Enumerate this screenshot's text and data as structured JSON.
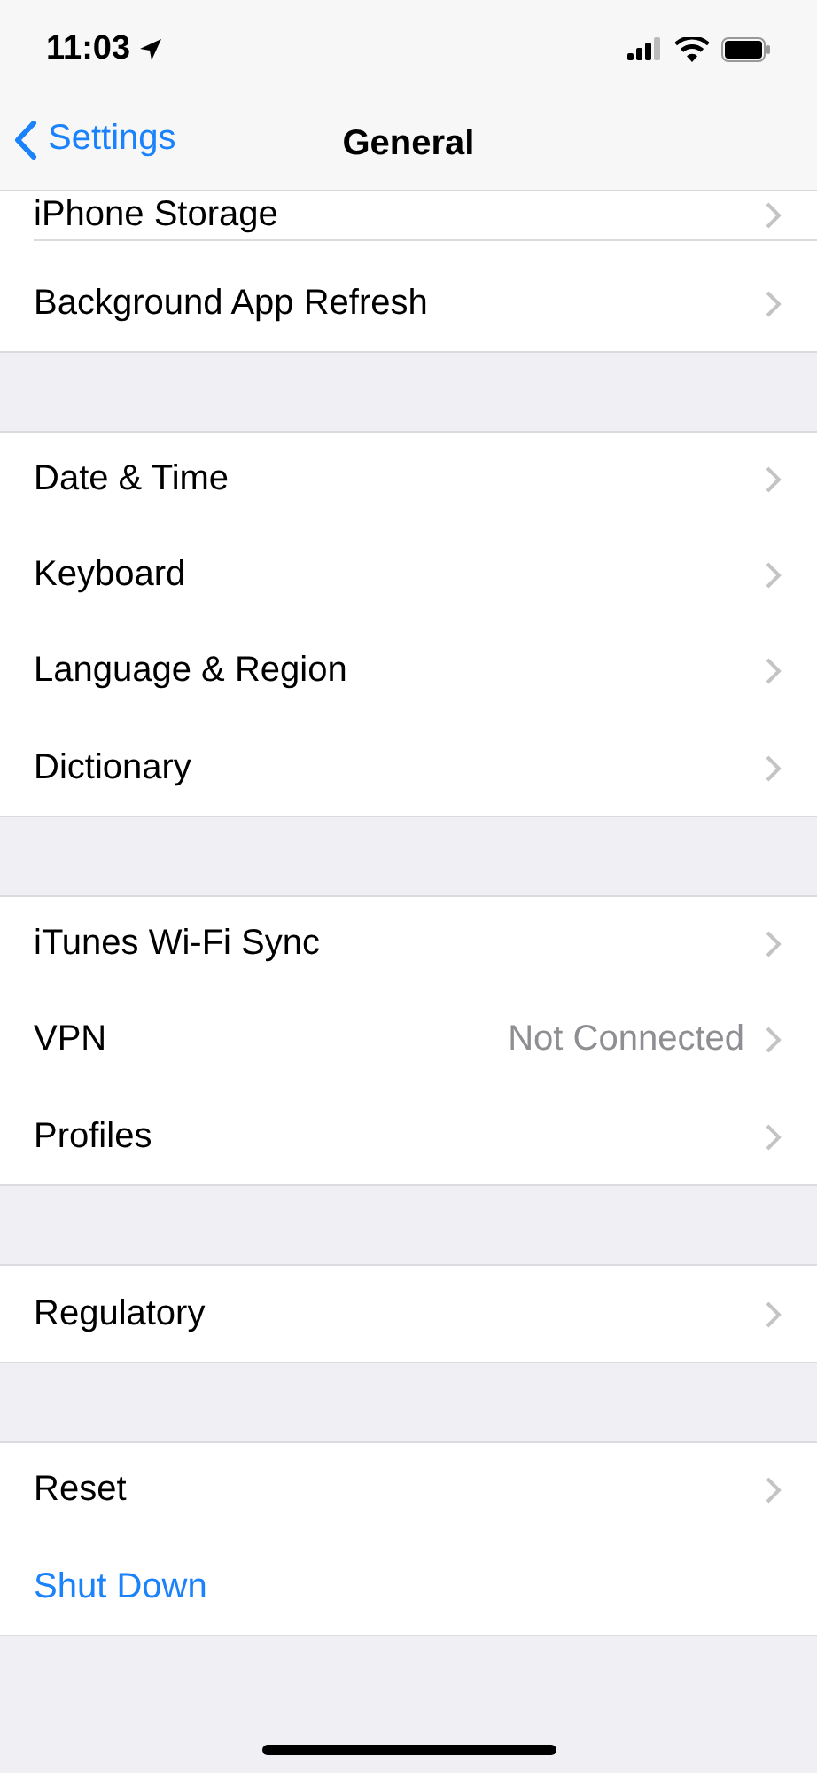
{
  "status_bar": {
    "time": "11:03",
    "location": true
  },
  "nav_bar": {
    "back": "Settings",
    "title": "General"
  },
  "groups": [
    {
      "rows": [
        {
          "kind": "link",
          "label": "iPhone Storage"
        },
        {
          "kind": "link",
          "label": "Background App Refresh"
        }
      ]
    },
    {
      "rows": [
        {
          "kind": "link",
          "label": "Date & Time"
        },
        {
          "kind": "link",
          "label": "Keyboard"
        },
        {
          "kind": "link",
          "label": "Language & Region"
        },
        {
          "kind": "link",
          "label": "Dictionary"
        }
      ]
    },
    {
      "rows": [
        {
          "kind": "link",
          "label": "iTunes Wi-Fi Sync"
        },
        {
          "kind": "link",
          "label": "VPN",
          "value": "Not Connected"
        },
        {
          "kind": "link",
          "label": "Profiles"
        }
      ]
    },
    {
      "rows": [
        {
          "kind": "link",
          "label": "Regulatory"
        }
      ]
    },
    {
      "rows": [
        {
          "kind": "link",
          "label": "Reset"
        },
        {
          "kind": "action",
          "label": "Shut Down"
        }
      ]
    }
  ]
}
